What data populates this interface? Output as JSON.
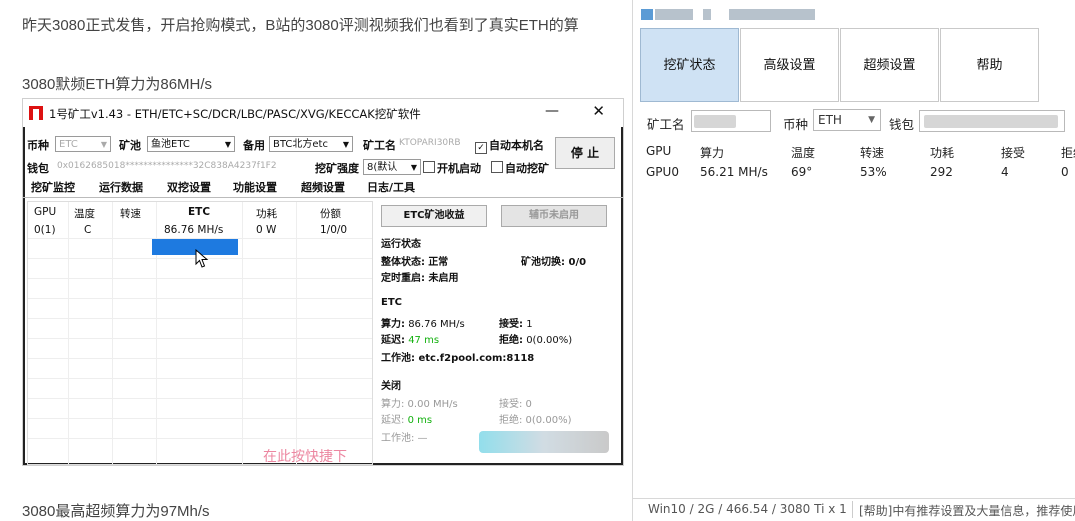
{
  "article": {
    "line1": "昨天3080正式发售，开启抢购模式，B站的3080评测视频我们也看到了真实ETH的算",
    "line2": "3080默频ETH算力为86MH/s",
    "line3": "3080最高超频算力为97Mh/s"
  },
  "embedded": {
    "title": "1号矿工v1.43 - ETH/ETC+SC/DCR/LBC/PASC/XVG/KECCAK挖矿软件",
    "min": "—",
    "close": "✕",
    "coin_label": "币种",
    "coin_value": "ETC",
    "pool_label": "矿池",
    "pool_value": "鱼池ETC",
    "backup_label": "备用",
    "backup_value": "BTC北方etc",
    "worker_label": "矿工名",
    "worker_value": "KTOPARI30RB",
    "auto_name": "自动本机名",
    "stop_btn": "停 止",
    "wallet_label": "钱包",
    "wallet_value": "0x0162685018***************32C838A4237f1F2",
    "intensity_label": "挖矿强度",
    "intensity_value": "8(默认",
    "boot_start": "开机启动",
    "auto_mine": "自动挖矿",
    "tabs": [
      "挖矿监控",
      "运行数据",
      "双挖设置",
      "功能设置",
      "超频设置",
      "日志/工具"
    ],
    "grid_headers": [
      "GPU",
      "温度",
      "转速",
      "ETC",
      "功耗",
      "份额"
    ],
    "grid_row": [
      "0(1)",
      "C",
      "",
      "86.76 MH/s",
      "0 W",
      "1/0/0"
    ],
    "btn_income": "ETC矿池收益",
    "btn_aux": "辅币未启用",
    "run_status": "运行状态",
    "overall_label": "整体状态:",
    "overall_value": "正常",
    "pool_switch": "矿池切换: 0/0",
    "timer_restart": "定时重启: 未启用",
    "etc_head": "ETC",
    "hash_label": "算力:",
    "hash_value": "86.76 MH/s",
    "accept_label": "接受:",
    "accept_value": "1",
    "latency_label": "延迟:",
    "latency_value": "47 ms",
    "reject_label": "拒绝:",
    "reject_value": "0(0.00%)",
    "workpool": "工作池: etc.f2pool.com:8118",
    "off_head": "关闭",
    "off_hash": "算力: 0.00 MH/s",
    "off_accept": "接受: 0",
    "off_latency_label": "延迟:",
    "off_latency_value": "0 ms",
    "off_reject": "拒绝: 0(0.00%)",
    "off_workpool": "工作池: —",
    "watermark": "在此按快捷下"
  },
  "app": {
    "tabs": [
      "挖矿状态",
      "高级设置",
      "超频设置",
      "帮助"
    ],
    "worker_label": "矿工名",
    "coin_label": "币种",
    "coin_value": "ETH",
    "wallet_label": "钱包",
    "headers": [
      "GPU",
      "算力",
      "温度",
      "转速",
      "功耗",
      "接受",
      "拒绝"
    ],
    "row": [
      "GPU0",
      "56.21 MH/s",
      "69°",
      "53%",
      "292",
      "4",
      "0"
    ],
    "status_left": "Win10 / 2G / 466.54 / 3080 Ti x 1",
    "status_right": "[帮助]中有推荐设置及大量信息，推荐使用"
  },
  "colors": {
    "active_tab": "#cfe2f4",
    "highlight": "#1e7ae0",
    "green": "#13b10f"
  }
}
